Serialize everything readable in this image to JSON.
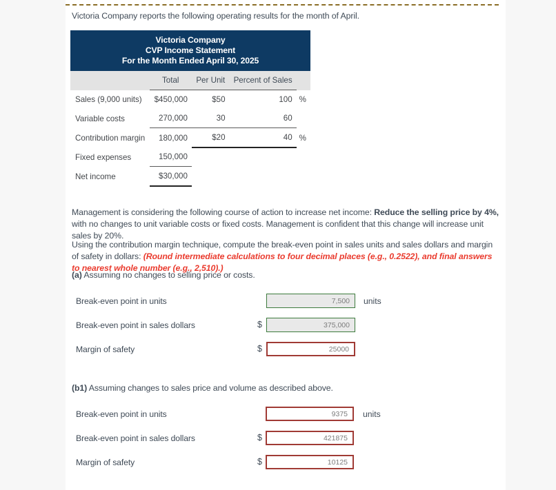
{
  "intro": "Victoria Company reports the following operating results for the month of April.",
  "statement": {
    "title_line1": "Victoria Company",
    "title_line2": "CVP Income Statement",
    "title_line3": "For the Month Ended April 30, 2025",
    "columns": [
      "Total",
      "Per Unit",
      "Percent of Sales"
    ],
    "rows": [
      {
        "label": "Sales (9,000 units)",
        "total": "$450,000",
        "per_unit": "$50",
        "percent": "100",
        "pct_sign": "%"
      },
      {
        "label": "Variable costs",
        "total": "270,000",
        "per_unit": "30",
        "percent": "60",
        "pct_sign": ""
      },
      {
        "label": "Contribution margin",
        "total": "180,000",
        "per_unit": "$20",
        "percent": "40",
        "pct_sign": "%"
      },
      {
        "label": "Fixed expenses",
        "total": "150,000",
        "per_unit": "",
        "percent": "",
        "pct_sign": ""
      },
      {
        "label": "Net income",
        "total": "$30,000",
        "per_unit": "",
        "percent": "",
        "pct_sign": ""
      }
    ]
  },
  "paragraphs": {
    "management_lead": "Management is considering the following course of action to increase net income: ",
    "management_bold": "Reduce the selling price by 4%,",
    "management_tail": " with no changes to unit variable costs or fixed costs. Management is confident that this change will increase unit sales by 20%.",
    "using_lead": "Using the contribution margin technique, compute the break-even point in sales units and sales dollars and margin of safety in dollars: ",
    "using_note": "(Round intermediate calculations to four decimal places (e.g., 0.2522), and final answers to nearest whole number (e.g., 2,510).)"
  },
  "part_a": {
    "marker": "(a)",
    "prompt": " Assuming no changes to selling price or costs.",
    "rows": [
      {
        "label": "Break-even point in units",
        "prefix": "",
        "value": "7,500",
        "suffix": "units",
        "state": "green"
      },
      {
        "label": "Break-even point in sales dollars",
        "prefix": "$",
        "value": "375,000",
        "suffix": "",
        "state": "green"
      },
      {
        "label": "Margin of safety",
        "prefix": "$",
        "value": "25000",
        "suffix": "",
        "state": "red"
      }
    ]
  },
  "part_b1": {
    "marker": "(b1)",
    "prompt": " Assuming changes to sales price and volume as described above.",
    "rows": [
      {
        "label": "Break-even point in units",
        "prefix": "",
        "value": "9375",
        "suffix": "units",
        "state": "red"
      },
      {
        "label": "Break-even point in sales dollars",
        "prefix": "$",
        "value": "421875",
        "suffix": "",
        "state": "red"
      },
      {
        "label": "Margin of safety",
        "prefix": "$",
        "value": "10125",
        "suffix": "",
        "state": "red"
      }
    ]
  },
  "colors": {
    "statement_header_bg": "#0e3a63",
    "column_header_bg": "#e3e3e3",
    "note_red": "#ea3b2e",
    "field_correct_border": "#3c7a3c",
    "field_incorrect_border": "#a03a34",
    "dashed_rule": "#8a6d25"
  }
}
